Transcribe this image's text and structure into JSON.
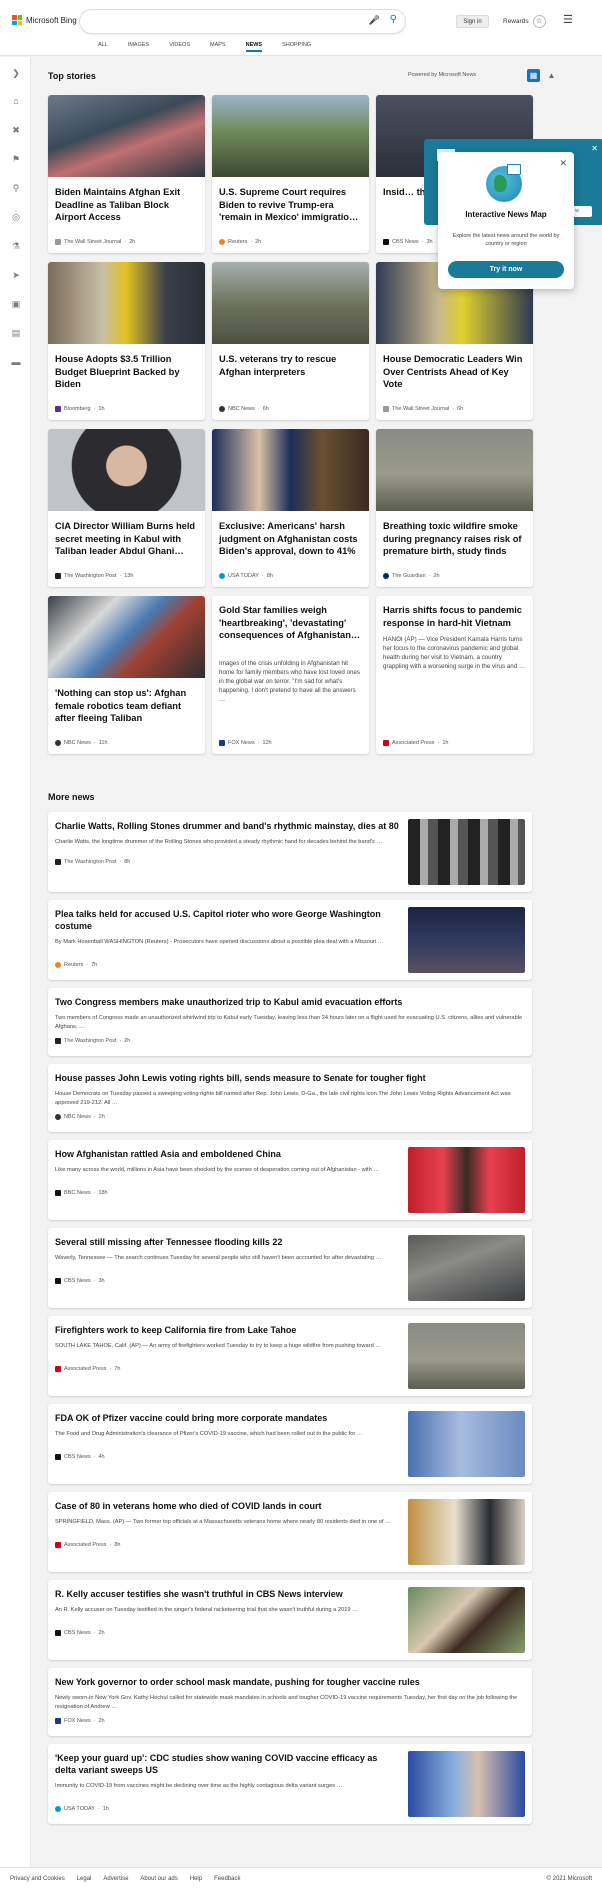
{
  "header": {
    "logo_text": "Microsoft Bing",
    "signin": "Sign in",
    "rewards": "Rewards",
    "tabs": [
      "ALL",
      "IMAGES",
      "VIDEOS",
      "MAPS",
      "NEWS",
      "SHOPPING"
    ],
    "active_tab": "NEWS",
    "icons": [
      "microphone-icon",
      "search-icon",
      "trophy-icon",
      "hamburger-menu-icon"
    ]
  },
  "colors": {
    "accent": "#1a73b8",
    "teal": "#1a7a9a"
  },
  "top_stories": {
    "title": "Top stories",
    "powered": "Powered by Microsoft News"
  },
  "cards": [
    {
      "title": "Biden Maintains Afghan Exit Deadline as Taliban Block Airport Access",
      "source": "The Wall Street Journal",
      "age": "2h"
    },
    {
      "title": "U.S. Supreme Court requires Biden to revive Trump-era 'remain in Mexico' immigratio…",
      "source": "Reuters",
      "age": "2h"
    },
    {
      "title": "Insid… thous… evac…",
      "source": "CBS News",
      "age": "3h"
    },
    {
      "title": "House Adopts $3.5 Trillion Budget Blueprint Backed by Biden",
      "source": "Bloomberg",
      "age": "1h"
    },
    {
      "title": "U.S. veterans try to rescue Afghan interpreters",
      "source": "NBC News",
      "age": "6h"
    },
    {
      "title": "House Democratic Leaders Win Over Centrists Ahead of Key Vote",
      "source": "The Wall Street Journal",
      "age": "6h"
    },
    {
      "title": "CIA Director William Burns held secret meeting in Kabul with Taliban leader Abdul Ghani…",
      "source": "The Washington Post",
      "age": "13h"
    },
    {
      "title": "Exclusive: Americans' harsh judgment on Afghanistan costs Biden's approval, down to 41%",
      "source": "USA TODAY",
      "age": "8h"
    },
    {
      "title": "Breathing toxic wildfire smoke during pregnancy raises risk of premature birth, study finds",
      "source": "The Guardian",
      "age": "2h"
    },
    {
      "title": "'Nothing can stop us': Afghan female robotics team defiant after fleeing Taliban",
      "source": "NBC News",
      "age": "11h"
    },
    {
      "title": "Gold Star families weigh 'heartbreaking', 'devastating' consequences of Afghanistan…",
      "abstract": "Images of the crisis unfolding in Afghanistan hit home for family members who have lost loved ones in the global war on terror. \"I'm sad for what's happening. I don't pretend to have all the answers …",
      "source": "FOX News",
      "age": "12h"
    },
    {
      "title": "Harris shifts focus to pandemic response in hard-hit Vietnam",
      "abstract": "HANOI (AP) — Vice President Kamala Harris turns her focus to the coronavirus pandemic and global health during her visit to Vietnam, a country grappling with a worsening surge in the virus and …",
      "source": "Associated Press",
      "age": "1h"
    }
  ],
  "popup": {
    "title": "Interactive News Map",
    "desc": "Explore the latest news around the world by country or region",
    "button": "Try it now",
    "back_button": "w"
  },
  "more": {
    "title": "More news",
    "items": [
      {
        "title": "Charlie Watts, Rolling Stones drummer and band's rhythmic mainstay, dies at 80",
        "desc": "Charlie Watts, the longtime drummer of the Rolling Stones who provided a steady rhythmic hand for decades behind the band's …",
        "source": "The Washington Post",
        "age": "8h"
      },
      {
        "title": "Plea talks held for accused U.S. Capitol rioter who wore George Washington costume",
        "desc": "By Mark Hosenball WASHINGTON (Reuters) - Prosecutors have opened discussions about a possible plea deal with a Missouri …",
        "source": "Reuters",
        "age": "7h"
      },
      {
        "title": "Two Congress members make unauthorized trip to Kabul amid evacuation efforts",
        "desc": "Two members of Congress made an unauthorized whirlwind trip to Kabul early Tuesday, leaving less than 24 hours later on a flight used for evacuating U.S. citizens, allies and vulnerable Afghans. …",
        "source": "The Washington Post",
        "age": "2h"
      },
      {
        "title": "House passes John Lewis voting rights bill, sends measure to Senate for tougher fight",
        "desc": "House Democrats on Tuesday passed a sweeping voting rights bill named after Rep. John Lewis, D-Ga., the late civil rights icon.The John Lewis Voting Rights Advancement Act was approved 219-212. All …",
        "source": "NBC News",
        "age": "2h"
      },
      {
        "title": "How Afghanistan rattled Asia and emboldened China",
        "desc": "Like many across the world, millions in Asia have been shocked by the scenes of desperation coming out of Afghanistan - with …",
        "source": "BBC News",
        "age": "18h"
      },
      {
        "title": "Several still missing after Tennessee flooding kills 22",
        "desc": "Waverly, Tennessee — The search continues Tuesday for several people who still haven't been accounted for after devastating …",
        "source": "CBS News",
        "age": "3h"
      },
      {
        "title": "Firefighters work to keep California fire from Lake Tahoe",
        "desc": "SOUTH LAKE TAHOE, Calif. (AP) — An army of firefighters worked Tuesday to try to keep a huge wildfire from pushing toward …",
        "source": "Associated Press",
        "age": "7h"
      },
      {
        "title": "FDA OK of Pfizer vaccine could bring more corporate mandates",
        "desc": "The Food and Drug Administration's clearance of Pfizer's COVID-19 vaccine, which had been rolled out to the public for …",
        "source": "CBS News",
        "age": "4h"
      },
      {
        "title": "Case of 80 in veterans home who died of COVID lands in court",
        "desc": "SPRINGFIELD, Mass. (AP) — Two former top officials at a Massachusetts veterans home where nearly 80 residents died in one of …",
        "source": "Associated Press",
        "age": "8h"
      },
      {
        "title": "R. Kelly accuser testifies she wasn't truthful in CBS News interview",
        "desc": "An R. Kelly accuser on Tuesday testified in the singer's federal racketeering trial that she wasn't truthful during a 2019 …",
        "source": "CBS News",
        "age": "2h"
      },
      {
        "title": "New York governor to order school mask mandate, pushing for tougher vaccine rules",
        "desc": "Newly sworn-in New York Gov. Kathy Hochul called for statewide mask mandates in schools and tougher COVID-19 vaccine requirements Tuesday, her first day on the job following the resignation of Andrew …",
        "source": "FOX News",
        "age": "2h"
      },
      {
        "title": "'Keep your guard up': CDC studies show waning COVID vaccine efficacy as delta variant sweeps US",
        "desc": "Immunity to COVID-19 from vaccines might be declining over time as the highly contagious delta variant surges …",
        "source": "USA TODAY",
        "age": "1h"
      }
    ]
  },
  "footer": {
    "links": [
      "Privacy and Cookies",
      "Legal",
      "Advertise",
      "About our ads",
      "Help",
      "Feedback"
    ],
    "copyright": "© 2021 Microsoft"
  }
}
